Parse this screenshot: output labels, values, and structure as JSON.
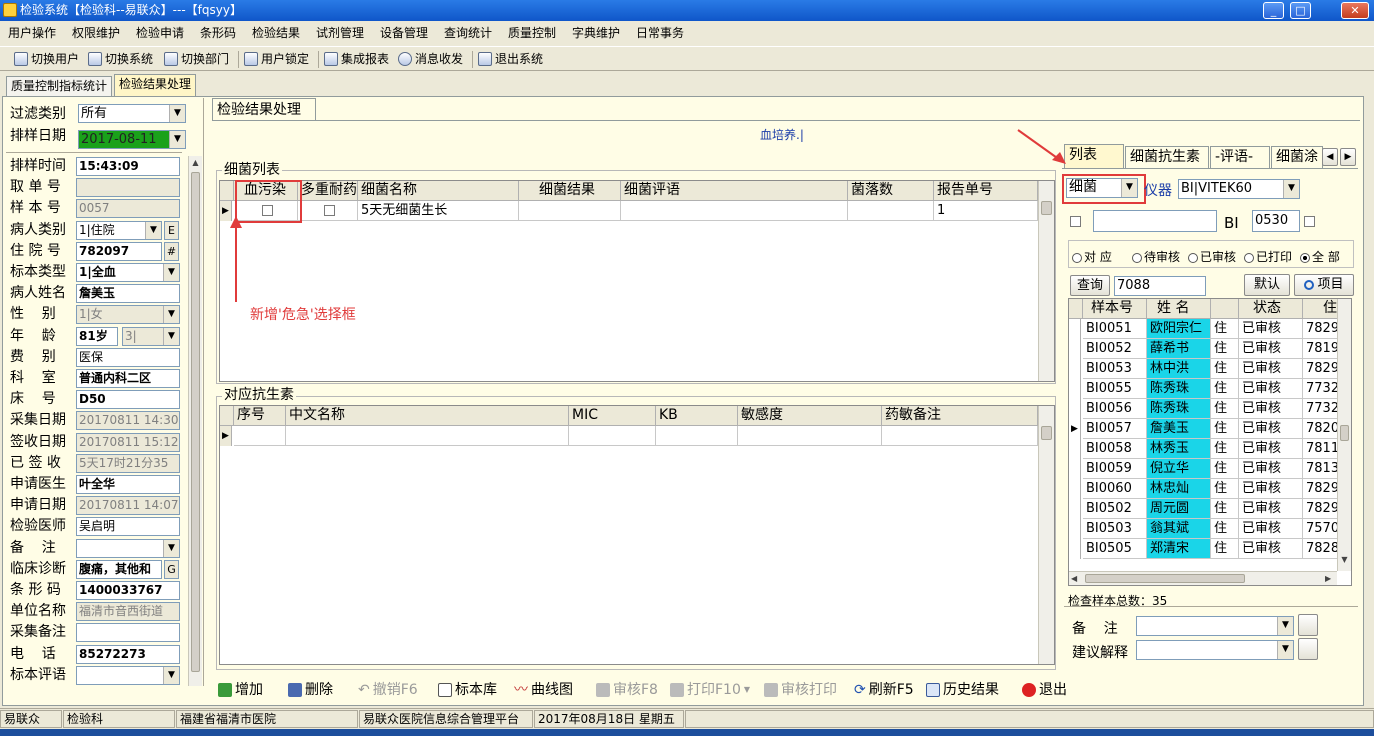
{
  "window": {
    "title": "检验系统【检验科--易联众】---【fqsyy】",
    "min": "_",
    "max": "□",
    "close": "✕"
  },
  "menu": [
    "用户操作",
    "权限维护",
    "检验申请",
    "条形码",
    "检验结果",
    "试剂管理",
    "设备管理",
    "查询统计",
    "质量控制",
    "字典维护",
    "日常事务"
  ],
  "toolbar": [
    "切换用户",
    "切换系统",
    "切换部门",
    "用户锁定",
    "集成报表",
    "消息收发",
    "退出系统"
  ],
  "outer_tabs": [
    "质量控制指标统计",
    "检验结果处理"
  ],
  "left": {
    "filter_label": "过滤类别",
    "filter_value": "所有",
    "date_label": "排样日期",
    "date_value": "2017-08-11",
    "fields": [
      {
        "label": "排样时间",
        "value": "15:43:09"
      },
      {
        "label": "取 单 号",
        "value": ""
      },
      {
        "label": "样 本 号",
        "value": "0057"
      },
      {
        "label": "病人类别",
        "value": "1|住院"
      },
      {
        "label": "住 院 号",
        "value": "782097"
      },
      {
        "label": "标本类型",
        "value": "1|全血"
      },
      {
        "label": "病人姓名",
        "value": "詹美玉"
      },
      {
        "label": "性    别",
        "value": "1|女"
      },
      {
        "label": "年    龄",
        "value": "81岁"
      },
      {
        "label": "费    别",
        "value": "医保"
      },
      {
        "label": "科    室",
        "value": "普通内科二区"
      },
      {
        "label": "床    号",
        "value": "D50"
      },
      {
        "label": "采集日期",
        "value": "20170811 14:30"
      },
      {
        "label": "签收日期",
        "value": "20170811 15:12"
      },
      {
        "label": "已 签 收",
        "value": "5天17时21分35"
      },
      {
        "label": "申请医生",
        "value": "叶全华"
      },
      {
        "label": "申请日期",
        "value": "20170811 14:07"
      },
      {
        "label": "检验医师",
        "value": "吴启明"
      },
      {
        "label": "备    注",
        "value": ""
      },
      {
        "label": "临床诊断",
        "value": "腹痛，其他和"
      },
      {
        "label": "条 形 码",
        "value": "1400033767"
      },
      {
        "label": "单位名称",
        "value": "福清市音西街道"
      },
      {
        "label": "采集备注",
        "value": ""
      },
      {
        "label": "电    话",
        "value": "85272273"
      },
      {
        "label": "标本评语",
        "value": ""
      }
    ],
    "age_unit": "3|",
    "btn_e": "E",
    "btn_hash": "#",
    "btn_g": "G"
  },
  "main": {
    "tab": "检验结果处理",
    "center_text": "血培养.|",
    "bacteria_group": "细菌列表",
    "bacteria_headers": [
      "血污染",
      "多重耐药",
      "细菌名称",
      "细菌结果",
      "细菌评语",
      "菌落数",
      "报告单号"
    ],
    "bacteria_rows": [
      {
        "name": "5天无细菌生长",
        "result": "",
        "comment": "",
        "count": "",
        "report": "1"
      }
    ],
    "antibiotic_group": "对应抗生素",
    "antibiotic_headers": [
      "序号",
      "中文名称",
      "MIC",
      "KB",
      "敏感度",
      "药敏备注"
    ],
    "annotation": "新增'危急'选择框"
  },
  "right": {
    "tabs": [
      "列表",
      "细菌抗生素",
      "-评语-",
      "细菌涂"
    ],
    "type_value": "细菌",
    "instrument_label": "仪器",
    "instrument_value": "BI|VITEK60",
    "bi_label": "BI",
    "bi_value": "0530",
    "radios": [
      "对 应",
      "待审核",
      "已审核",
      "已打印",
      "全 部"
    ],
    "query_btn": "查询",
    "query_value": "7088",
    "default_btn": "默认",
    "project_btn": "项目",
    "list_headers": [
      "样本号",
      "姓 名",
      "",
      "状态",
      "住"
    ],
    "rows": [
      [
        "BI0051",
        "欧阳宗仁",
        "住",
        "已审核",
        "7829"
      ],
      [
        "BI0052",
        "薛希书",
        "住",
        "已审核",
        "7819"
      ],
      [
        "BI0053",
        "林中洪",
        "住",
        "已审核",
        "7829"
      ],
      [
        "BI0055",
        "陈秀珠",
        "住",
        "已审核",
        "7732"
      ],
      [
        "BI0056",
        "陈秀珠",
        "住",
        "已审核",
        "7732"
      ],
      [
        "BI0057",
        "詹美玉",
        "住",
        "已审核",
        "7820"
      ],
      [
        "BI0058",
        "林秀玉",
        "住",
        "已审核",
        "7811"
      ],
      [
        "BI0059",
        "倪立华",
        "住",
        "已审核",
        "7813"
      ],
      [
        "BI0060",
        "林忠灿",
        "住",
        "已审核",
        "7829"
      ],
      [
        "BI0502",
        "周元圆",
        "住",
        "已审核",
        "7829"
      ],
      [
        "BI0503",
        "翁其斌",
        "住",
        "已审核",
        "7570"
      ],
      [
        "BI0505",
        "郑清宋",
        "住",
        "已审核",
        "7828"
      ]
    ],
    "total_label": "检查样本总数：35",
    "remark_label": "备    注",
    "suggest_label": "建议解释"
  },
  "bottom": [
    "增加",
    "删除",
    "撤销F6",
    "标本库",
    "曲线图",
    "审核F8",
    "打印F10",
    "审核打印",
    "刷新F5",
    "历史结果",
    "退出"
  ],
  "status": [
    "易联众",
    "检验科",
    "福建省福清市医院",
    "易联众医院信息综合管理平台",
    "2017年08月18日 星期五"
  ]
}
